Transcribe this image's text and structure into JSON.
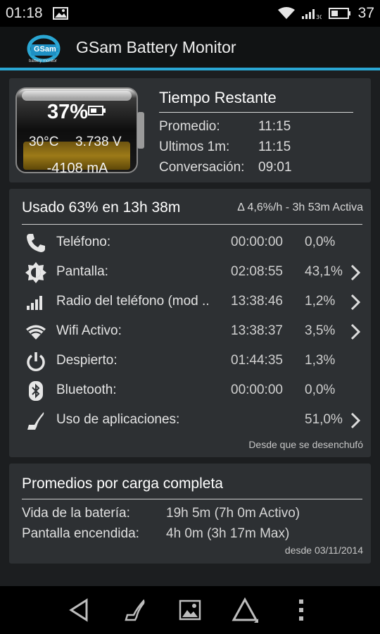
{
  "status_bar": {
    "time": "01:18",
    "battery_percent": "37",
    "network": "3G",
    "icons": [
      "image-notification-icon",
      "wifi-signal-icon",
      "cell-signal-icon",
      "battery-icon"
    ]
  },
  "app_bar": {
    "title": "GSam Battery Monitor",
    "logo_text": "GSam",
    "logo_subtext": "battery monitor",
    "accent_color": "#2aa7d4"
  },
  "battery": {
    "percent": "37%",
    "level": 0.37,
    "temperature": "30°C",
    "voltage": "3.738 V",
    "current": "-4108 mA",
    "fill_color": "#8a6a14"
  },
  "time_remaining": {
    "title": "Tiempo Restante",
    "rows": [
      {
        "label": "Promedio:",
        "value": "11:15"
      },
      {
        "label": "Ultimos 1m:",
        "value": "11:15"
      },
      {
        "label": "Conversación:",
        "value": "09:01"
      }
    ]
  },
  "usage": {
    "title": "Usado 63% en 13h 38m",
    "rate": "Δ 4,6%/h - 3h 53m Activa",
    "rows": [
      {
        "icon": "phone-icon",
        "label": "Teléfono:",
        "time": "00:00:00",
        "percent": "0,0%",
        "has_detail": false
      },
      {
        "icon": "brightness-icon",
        "label": "Pantalla:",
        "time": "02:08:55",
        "percent": "43,1%",
        "has_detail": true
      },
      {
        "icon": "signal-bars-icon",
        "label": "Radio del teléfono (mod ..",
        "time": "13:38:46",
        "percent": "1,2%",
        "has_detail": true
      },
      {
        "icon": "wifi-icon",
        "label": "Wifi Activo:",
        "time": "13:38:37",
        "percent": "3,5%",
        "has_detail": true
      },
      {
        "icon": "power-icon",
        "label": "Despierto:",
        "time": "01:44:35",
        "percent": "1,3%",
        "has_detail": false
      },
      {
        "icon": "bluetooth-icon",
        "label": "Bluetooth:",
        "time": "00:00:00",
        "percent": "0,0%",
        "has_detail": false
      },
      {
        "icon": "app-usage-icon",
        "label": "Uso de aplicaciones:",
        "time": "",
        "percent": "51,0%",
        "has_detail": true
      }
    ],
    "footer": "Desde que se desenchufó"
  },
  "averages": {
    "title": "Promedios por carga completa",
    "rows": [
      {
        "label": "Vida de la batería:",
        "value": "19h 5m (7h 0m Activo)"
      },
      {
        "label": "Pantalla encendida:",
        "value": "4h 0m (3h 17m Max)"
      }
    ],
    "footer": "desde 03/11/2014"
  },
  "nav_bar": {
    "buttons": [
      "back-icon",
      "app-usage-icon",
      "picture-icon",
      "triangle-warning-icon",
      "overflow-menu-icon"
    ]
  }
}
